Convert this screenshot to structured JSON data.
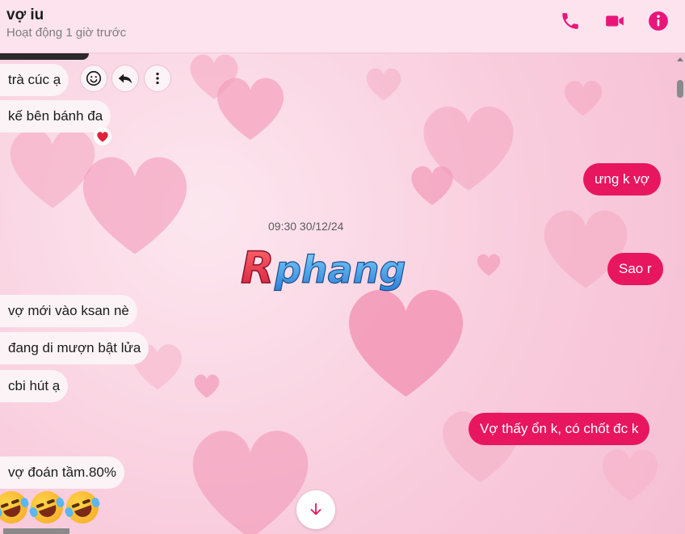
{
  "header": {
    "name": "vợ iu",
    "status": "Hoạt động 1 giờ trước",
    "accent": "#e8167a"
  },
  "messages": [
    {
      "side": "in",
      "text": "trà cúc ạ"
    },
    {
      "side": "in",
      "text": "kế bên bánh đa",
      "reaction": "heart"
    },
    {
      "side": "out",
      "text": "ưng k vợ"
    },
    {
      "side": "out",
      "text": "Sao r"
    },
    {
      "side": "in",
      "text": "vợ mới vào ksan nè"
    },
    {
      "side": "in",
      "text": "đang di mượn bật lửa"
    },
    {
      "side": "in",
      "text": "cbi hút ạ"
    },
    {
      "side": "out",
      "text": "Vợ thấy ổn k, có chốt đc k"
    },
    {
      "side": "in",
      "text": "vợ đoán tầm.80%"
    }
  ],
  "timestamp": "09:30 30/12/24",
  "watermark": "Rphang",
  "message_actions": [
    "react-icon",
    "reply-icon",
    "more-icon"
  ],
  "emojis": [
    "rofl",
    "rofl",
    "rofl"
  ],
  "colors": {
    "outgoing": "#e8165f",
    "incoming": "#fbf3f6",
    "background": "#f9cddd"
  }
}
